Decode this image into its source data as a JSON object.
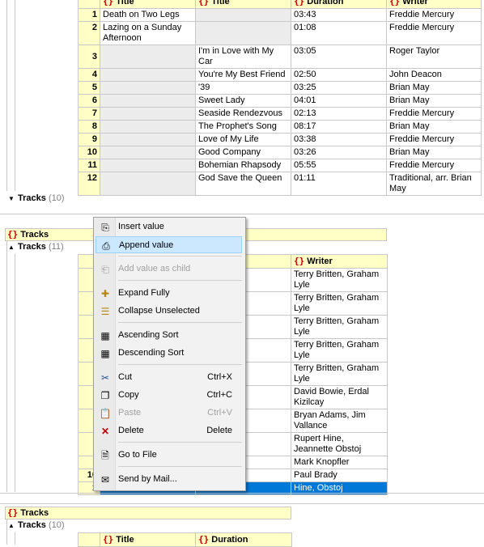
{
  "top_table": {
    "headers": [
      "{}",
      "Title",
      "Duration",
      "Writer"
    ],
    "rows": [
      {
        "n": "1",
        "title": "Death on Two Legs",
        "a": "",
        "dur": "03:43",
        "writer": "Freddie Mercury"
      },
      {
        "n": "2",
        "title": "Lazing on a Sunday Afternoon",
        "a": "",
        "dur": "01:08",
        "writer": "Freddie Mercury"
      },
      {
        "n": "3",
        "title": "",
        "a": "I'm in Love with My Car",
        "dur": "03:05",
        "writer": "Roger Taylor"
      },
      {
        "n": "4",
        "title": "",
        "a": "You're My Best Friend",
        "dur": "02:50",
        "writer": "John Deacon"
      },
      {
        "n": "5",
        "title": "",
        "a": "'39",
        "dur": "03:25",
        "writer": "Brian May"
      },
      {
        "n": "6",
        "title": "",
        "a": "Sweet Lady",
        "dur": "04:01",
        "writer": "Brian May"
      },
      {
        "n": "7",
        "title": "",
        "a": "Seaside Rendezvous",
        "dur": "02:13",
        "writer": "Freddie Mercury"
      },
      {
        "n": "8",
        "title": "",
        "a": "The Prophet's Song",
        "dur": "08:17",
        "writer": "Brian May"
      },
      {
        "n": "9",
        "title": "",
        "a": "Love of My Life",
        "dur": "03:38",
        "writer": "Freddie Mercury"
      },
      {
        "n": "10",
        "title": "",
        "a": "Good Company",
        "dur": "03:26",
        "writer": "Brian May"
      },
      {
        "n": "11",
        "title": "",
        "a": "Bohemian Rhapsody",
        "dur": "05:55",
        "writer": "Freddie Mercury"
      },
      {
        "n": "12",
        "title": "",
        "a": "God Save the Queen",
        "dur": "01:11",
        "writer": "Traditional, arr. Brian May"
      }
    ]
  },
  "tracks_collapsed": {
    "label": "Tracks",
    "count": "(10)"
  },
  "tracks_block2": {
    "header": "Tracks",
    "label": "Tracks",
    "count": "(11)",
    "col_partial": "n",
    "col_writer": "Writer",
    "writers": [
      "Terry Britten, Graham Lyle",
      "Terry Britten, Graham Lyle",
      "Terry Britten, Graham Lyle",
      "Terry Britten, Graham Lyle",
      "Terry Britten, Graham Lyle",
      "David Bowie, Erdal Kizilcay",
      "Bryan Adams, Jim Vallance",
      "Rupert Hine, Jeannette Obstoj",
      "Mark Knopfler",
      "Paul Brady",
      "Hine, Obstoj"
    ],
    "num_10": "10",
    "num_11": "1"
  },
  "tracks_block3": {
    "header": "Tracks",
    "label": "Tracks",
    "count": "(10)",
    "col_title": "Title",
    "col_duration": "Duration"
  },
  "context_menu": {
    "items": [
      {
        "label": "Insert value",
        "shortcut": "",
        "icon": "insert-value-icon"
      },
      {
        "label": "Append value",
        "shortcut": "",
        "icon": "append-value-icon"
      },
      {
        "label": "Add value as child",
        "shortcut": "",
        "icon": "add-child-icon"
      },
      {
        "label": "Expand Fully",
        "shortcut": "",
        "icon": "expand-icon"
      },
      {
        "label": "Collapse Unselected",
        "shortcut": "",
        "icon": "collapse-icon"
      },
      {
        "label": "Ascending Sort",
        "shortcut": "",
        "icon": "sort-ascending-icon"
      },
      {
        "label": "Descending Sort",
        "shortcut": "",
        "icon": "sort-descending-icon"
      },
      {
        "label": "Cut",
        "shortcut": "Ctrl+X",
        "icon": "cut-icon"
      },
      {
        "label": "Copy",
        "shortcut": "Ctrl+C",
        "icon": "copy-icon"
      },
      {
        "label": "Paste",
        "shortcut": "Ctrl+V",
        "icon": "paste-icon"
      },
      {
        "label": "Delete",
        "shortcut": "Delete",
        "icon": "delete-icon"
      },
      {
        "label": "Go to File",
        "shortcut": "",
        "icon": "go-to-file-icon"
      },
      {
        "label": "Send by Mail...",
        "shortcut": "",
        "icon": "send-mail-icon"
      }
    ]
  },
  "colors": {
    "header_bg": "#ffffc6",
    "selection": "#0078d7",
    "menu_highlight": "#cce8ff"
  }
}
